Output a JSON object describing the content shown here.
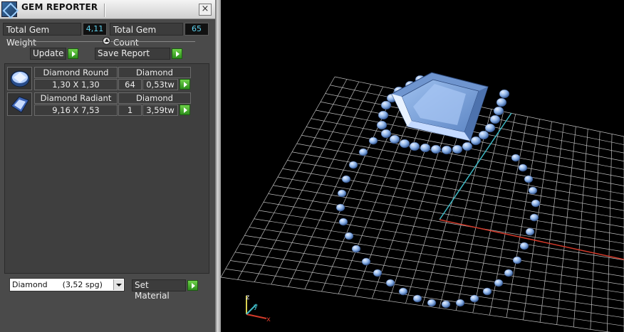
{
  "panel": {
    "title": "GEM REPORTER",
    "close_glyph": "×",
    "total_weight_label": "Total Gem Weight",
    "total_weight_value": "4,11",
    "total_count_label": "Total Gem Count",
    "total_count_value": "65",
    "update_label": "Update",
    "save_report_label": "Save Report",
    "gems": [
      {
        "icon": "round-gem-icon",
        "name": "Diamond Round",
        "material": "Diamond",
        "size": "1,30 X 1,30",
        "count": "64",
        "weight": "0,53tw"
      },
      {
        "icon": "radiant-gem-icon",
        "name": "Diamond Radiant",
        "material": "Diamond",
        "size": "9,16 X 7,53",
        "count": "1",
        "weight": "3,59tw"
      }
    ],
    "material_select": "Diamond      (3,52 spg)",
    "set_material_label": "Set Material"
  },
  "viewport": {
    "axis_labels": {
      "x": "x",
      "y": "y",
      "z": "z"
    },
    "colors": {
      "gem": "#8fb4e8",
      "grid": "#e6e6e6",
      "x_axis": "#d23a2a",
      "y_axis": "#3fb8c4"
    }
  }
}
